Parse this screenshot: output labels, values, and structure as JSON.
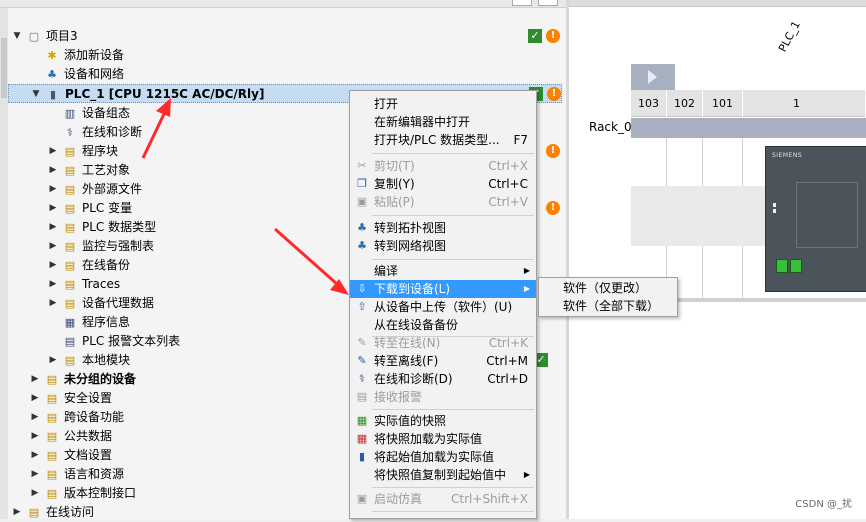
{
  "tree": {
    "root": {
      "label": "项目3"
    },
    "items": [
      {
        "label": "添加新设备"
      },
      {
        "label": "设备和网络"
      },
      {
        "label": "PLC_1 [CPU 1215C AC/DC/Rly]"
      },
      {
        "label": "设备组态"
      },
      {
        "label": "在线和诊断"
      },
      {
        "label": "程序块"
      },
      {
        "label": "工艺对象"
      },
      {
        "label": "外部源文件"
      },
      {
        "label": "PLC 变量"
      },
      {
        "label": "PLC 数据类型"
      },
      {
        "label": "监控与强制表"
      },
      {
        "label": "在线备份"
      },
      {
        "label": "Traces"
      },
      {
        "label": "设备代理数据"
      },
      {
        "label": "程序信息"
      },
      {
        "label": "PLC 报警文本列表"
      },
      {
        "label": "本地模块"
      },
      {
        "label": "未分组的设备"
      },
      {
        "label": "安全设置"
      },
      {
        "label": "跨设备功能"
      },
      {
        "label": "公共数据"
      },
      {
        "label": "文档设置"
      },
      {
        "label": "语言和资源"
      },
      {
        "label": "版本控制接口"
      },
      {
        "label": "在线访问"
      }
    ]
  },
  "device_view": {
    "device_title": "PLC_1",
    "rack_label": "Rack_0",
    "slots": [
      "103",
      "102",
      "101",
      "1"
    ],
    "cpu_brand": "SIEMENS"
  },
  "context_menu": {
    "items": [
      {
        "label": "打开",
        "shortcut": ""
      },
      {
        "label": "在新编辑器中打开",
        "shortcut": ""
      },
      {
        "label": "打开块/PLC 数据类型...",
        "shortcut": "F7"
      },
      {
        "label": "剪切(T)",
        "shortcut": "Ctrl+X"
      },
      {
        "label": "复制(Y)",
        "shortcut": "Ctrl+C"
      },
      {
        "label": "粘贴(P)",
        "shortcut": "Ctrl+V"
      },
      {
        "label": "转到拓扑视图",
        "shortcut": ""
      },
      {
        "label": "转到网络视图",
        "shortcut": ""
      },
      {
        "label": "编译",
        "shortcut": ""
      },
      {
        "label": "下载到设备(L)",
        "shortcut": ""
      },
      {
        "label": "从设备中上传（软件）(U)",
        "shortcut": ""
      },
      {
        "label": "从在线设备备份",
        "shortcut": ""
      },
      {
        "label": "转至在线(N)",
        "shortcut": "Ctrl+K"
      },
      {
        "label": "转至离线(F)",
        "shortcut": "Ctrl+M"
      },
      {
        "label": "在线和诊断(D)",
        "shortcut": "Ctrl+D"
      },
      {
        "label": "接收报警",
        "shortcut": ""
      },
      {
        "label": "实际值的快照",
        "shortcut": ""
      },
      {
        "label": "将快照加载为实际值",
        "shortcut": ""
      },
      {
        "label": "将起始值加载为实际值",
        "shortcut": ""
      },
      {
        "label": "将快照值复制到起始值中",
        "shortcut": ""
      },
      {
        "label": "启动仿真",
        "shortcut": "Ctrl+Shift+X"
      }
    ]
  },
  "submenu": {
    "items": [
      {
        "label": "软件（仅更改）"
      },
      {
        "label": "软件（全部下载）"
      }
    ]
  },
  "watermark": "CSDN @_扰",
  "colors": {
    "selection": "#c6dcf3",
    "menu_highlight": "#3399ff",
    "status_ok": "#2e8b2e",
    "status_warn": "#ff7f00",
    "annotation": "#ff2a2a"
  }
}
